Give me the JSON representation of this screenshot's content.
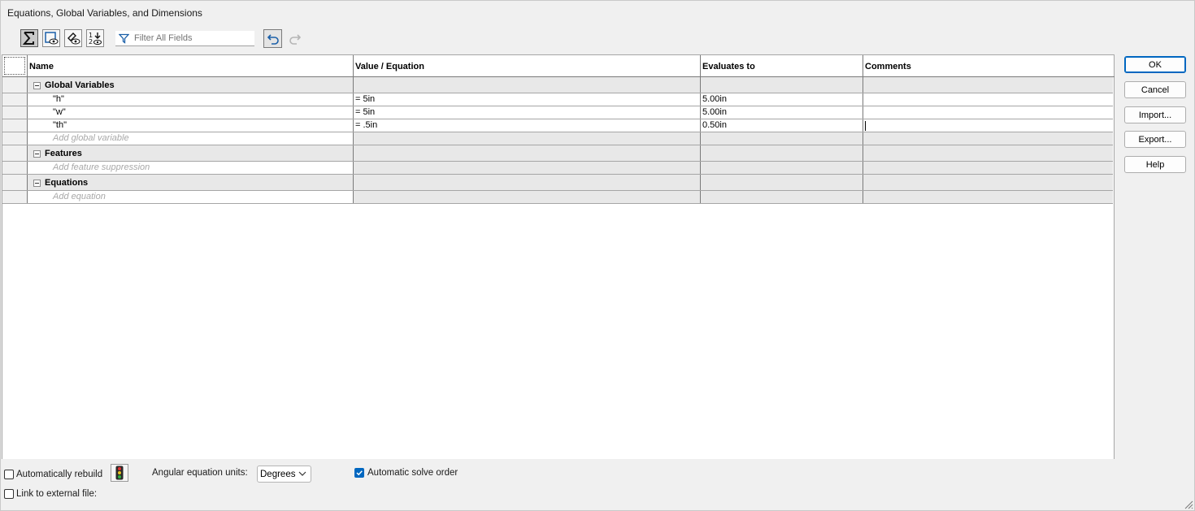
{
  "window": {
    "title": "Equations, Global Variables, and Dimensions"
  },
  "toolbar": {
    "buttons": [
      {
        "name": "equation-view-icon",
        "active": true
      },
      {
        "name": "sketch-equation-view-icon",
        "active": false
      },
      {
        "name": "dimension-view-icon",
        "active": false
      },
      {
        "name": "ordered-view-icon",
        "active": false
      }
    ],
    "filter": {
      "placeholder": "Filter All Fields",
      "value": ""
    },
    "undo": "undo-icon",
    "redo": "redo-icon"
  },
  "grid": {
    "columns": [
      "Name",
      "Value / Equation",
      "Evaluates to",
      "Comments"
    ],
    "groups": [
      {
        "title": "Global Variables",
        "rows": [
          {
            "name": "\"h\"",
            "value": "= 5in",
            "evaluates": "5.00in",
            "comment": ""
          },
          {
            "name": "\"w\"",
            "value": "= 5in",
            "evaluates": "5.00in",
            "comment": ""
          },
          {
            "name": "\"th\"",
            "value": "= .5in",
            "evaluates": "0.50in",
            "comment": ""
          }
        ],
        "add": "Add global variable"
      },
      {
        "title": "Features",
        "rows": [],
        "add": "Add feature suppression"
      },
      {
        "title": "Equations",
        "rows": [],
        "add": "Add equation"
      }
    ]
  },
  "buttons": {
    "ok": "OK",
    "cancel": "Cancel",
    "import": "Import...",
    "export": "Export...",
    "help": "Help"
  },
  "bottom": {
    "auto_rebuild": {
      "label": "Automatically rebuild",
      "checked": false
    },
    "rebuild_icon": "traffic-light-icon",
    "angular_units": {
      "label": "Angular equation units:",
      "value": "Degrees"
    },
    "auto_solve": {
      "label": "Automatic solve order",
      "checked": true
    },
    "link_external": {
      "label": "Link to external file:",
      "checked": false
    }
  },
  "colors": {
    "accent": "#0067c0",
    "dialog_bg": "#f0f0f0",
    "gray_cell": "#e8e8e8"
  }
}
